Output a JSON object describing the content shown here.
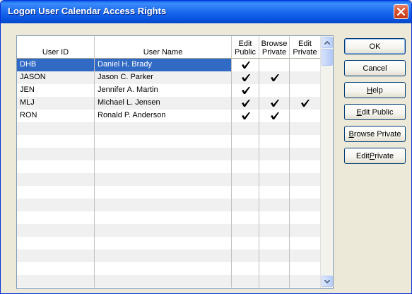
{
  "window": {
    "title": "Logon User Calendar Access Rights"
  },
  "grid": {
    "columns": [
      {
        "key": "userid",
        "label_lines": [
          "User ID"
        ]
      },
      {
        "key": "username",
        "label_lines": [
          "User Name"
        ]
      },
      {
        "key": "edit_public",
        "label_lines": [
          "Edit",
          "Public"
        ]
      },
      {
        "key": "browse_private",
        "label_lines": [
          "Browse",
          "Private"
        ]
      },
      {
        "key": "edit_private",
        "label_lines": [
          "Edit",
          "Private"
        ]
      }
    ],
    "rows": [
      {
        "userid": "DHB",
        "username": "Daniel H. Brady",
        "edit_public": true,
        "browse_private": false,
        "edit_private": false,
        "selected": true
      },
      {
        "userid": "JASON",
        "username": "Jason C. Parker",
        "edit_public": true,
        "browse_private": true,
        "edit_private": false,
        "selected": false
      },
      {
        "userid": "JEN",
        "username": "Jennifer A. Martin",
        "edit_public": true,
        "browse_private": false,
        "edit_private": false,
        "selected": false
      },
      {
        "userid": "MLJ",
        "username": "Michael L. Jensen",
        "edit_public": true,
        "browse_private": true,
        "edit_private": true,
        "selected": false
      },
      {
        "userid": "RON",
        "username": "Ronald P. Anderson",
        "edit_public": true,
        "browse_private": true,
        "edit_private": false,
        "selected": false
      }
    ],
    "check_icon": "checkmark-icon"
  },
  "buttons": {
    "ok": "OK",
    "cancel": "Cancel",
    "help": "Help",
    "edit_public": "Edit Public",
    "browse_private": "Browse Private",
    "edit_private": "Edit Private"
  },
  "colors": {
    "selection": "#316AC5",
    "titlebar": "#0A5FE8",
    "close": "#D8502E"
  }
}
